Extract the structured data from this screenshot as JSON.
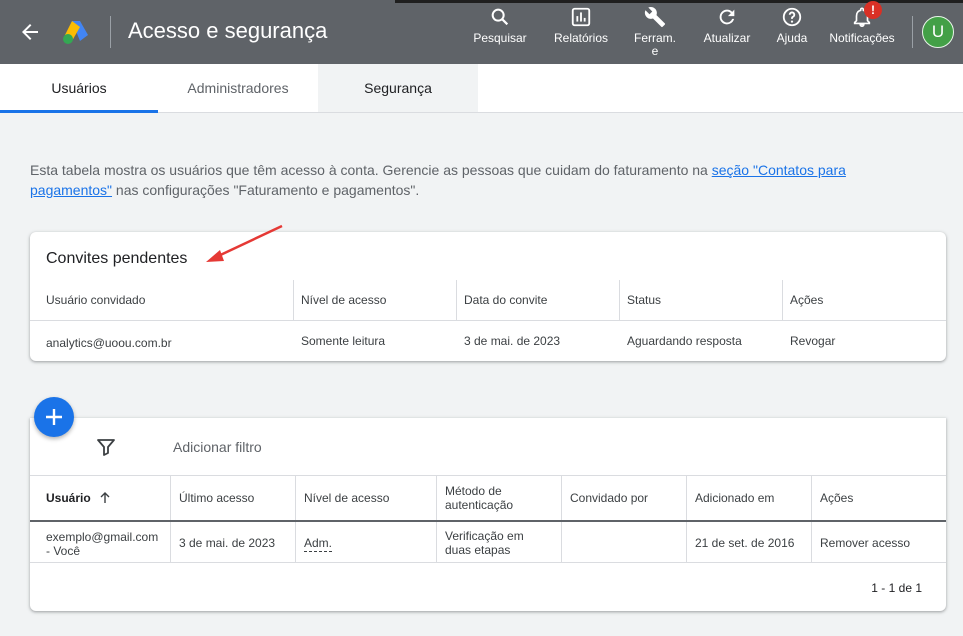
{
  "header": {
    "title": "Acesso e segurança",
    "tools": [
      {
        "label": "Pesquisar",
        "icon": "search-icon"
      },
      {
        "label": "Relatórios",
        "icon": "reports-icon"
      },
      {
        "label": "Ferram.\ne",
        "icon": "wrench-icon"
      },
      {
        "label": "Atualizar",
        "icon": "refresh-icon"
      },
      {
        "label": "Ajuda",
        "icon": "help-icon"
      },
      {
        "label": "Notificações",
        "icon": "bell-icon"
      }
    ],
    "notification_badge": "!",
    "avatar_letter": "U",
    "colors": {
      "bar": "#5f6368",
      "avatar": "#43a047",
      "badge": "#d93025"
    }
  },
  "tabs": [
    {
      "label": "Usuários",
      "active": true
    },
    {
      "label": "Administradores",
      "active": false
    },
    {
      "label": "Segurança",
      "active": false
    }
  ],
  "description": {
    "text_before": "Esta tabela mostra os usuários que têm acesso à conta. Gerencie as pessoas que cuidam do faturamento na ",
    "link": "seção \"Contatos para pagamentos\"",
    "text_after": " nas configurações \"Faturamento e pagamentos\"."
  },
  "pending": {
    "title": "Convites pendentes",
    "columns": [
      "Usuário convidado",
      "Nível de acesso",
      "Data do convite",
      "Status",
      "Ações"
    ],
    "rows": [
      [
        "analytics@uoou.com.br",
        "Somente leitura",
        "3 de mai. de 2023",
        "Aguardando resposta",
        "Revogar"
      ]
    ]
  },
  "users": {
    "filter_label": "Adicionar filtro",
    "columns": [
      "Usuário",
      "Último acesso",
      "Nível de acesso",
      "Método de\nautenticação",
      "Convidado por",
      "Adicionado em",
      "Ações"
    ],
    "rows": [
      [
        "exemplo@gmail.com\n- Você",
        "3 de mai. de 2023",
        "Adm.",
        "Verificação em\nduas etapas",
        "",
        "21 de set. de 2016",
        "Remover acesso"
      ]
    ],
    "pagination": "1 - 1 de 1"
  },
  "accent": "#1a73e8",
  "annotation_arrow_color": "#e53935"
}
